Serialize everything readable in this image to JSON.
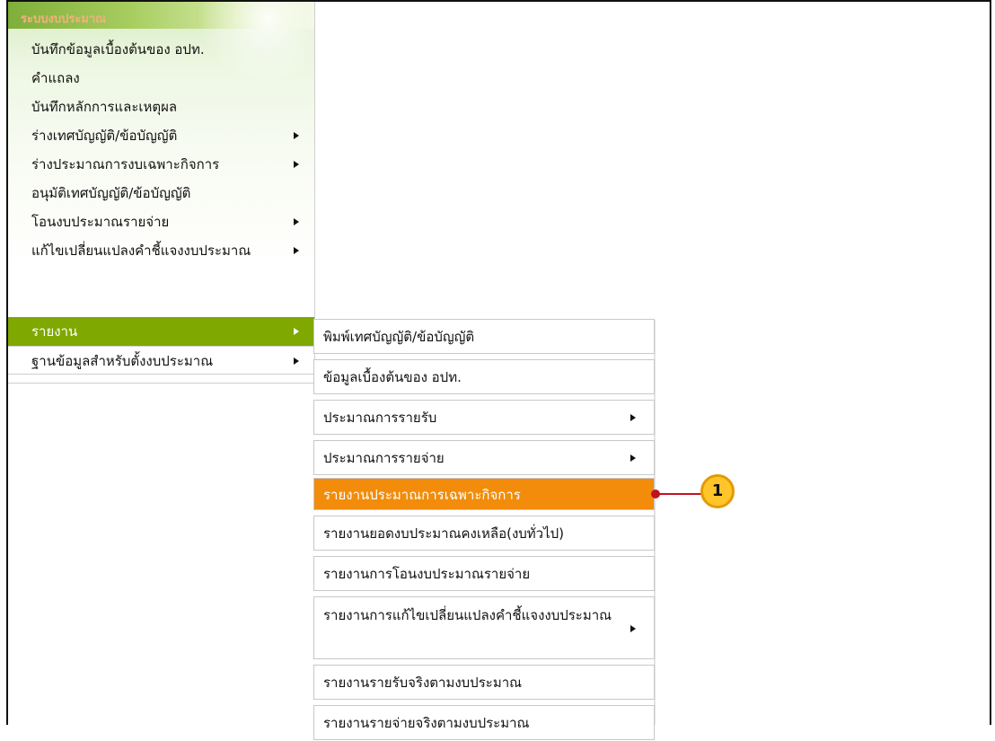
{
  "sidebar": {
    "title": "ระบบงบประมาณ",
    "items": [
      {
        "label": "บันทึกข้อมูลเบื้องต้นของ อปท.",
        "has_submenu": false
      },
      {
        "label": "คำแถลง",
        "has_submenu": false
      },
      {
        "label": "บันทึกหลักการและเหตุผล",
        "has_submenu": false
      },
      {
        "label": "ร่างเทศบัญญัติ/ข้อบัญญัติ",
        "has_submenu": true
      },
      {
        "label": "ร่างประมาณการงบเฉพาะกิจการ",
        "has_submenu": true
      },
      {
        "label": "อนุมัติเทศบัญญัติ/ข้อบัญญัติ",
        "has_submenu": false
      },
      {
        "label": "โอนงบประมาณรายจ่าย",
        "has_submenu": true
      },
      {
        "label": "แก้ไขเปลี่ยนแปลงคำชี้แจงงบประมาณ",
        "has_submenu": true
      },
      {
        "label": "รายงาน",
        "has_submenu": true,
        "active": true
      },
      {
        "label": "ฐานข้อมูลสำหรับตั้งงบประมาณ",
        "has_submenu": true
      }
    ]
  },
  "submenu": {
    "items": [
      {
        "label": "พิมพ์เทศบัญญัติ/ข้อบัญญัติ",
        "has_submenu": false
      },
      {
        "label": "ข้อมูลเบื้องต้นของ อปท.",
        "has_submenu": false
      },
      {
        "label": "ประมาณการรายรับ",
        "has_submenu": true
      },
      {
        "label": "ประมาณการรายจ่าย",
        "has_submenu": true
      },
      {
        "label": "รายงานประมาณการเฉพาะกิจการ",
        "has_submenu": false,
        "highlighted": true
      },
      {
        "label": "รายงานยอดงบประมาณคงเหลือ(งบทั่วไป)",
        "has_submenu": false
      },
      {
        "label": "รายงานการโอนงบประมาณรายจ่าย",
        "has_submenu": false
      },
      {
        "label": "รายงานการแก้ไขเปลี่ยนแปลงคำชี้แจงงบประมาณ",
        "has_submenu": true
      },
      {
        "label": "รายงานรายรับจริงตามงบประมาณ",
        "has_submenu": false
      },
      {
        "label": "รายงานรายจ่ายจริงตามงบประมาณ",
        "has_submenu": false
      }
    ]
  },
  "callout": {
    "number": "1"
  },
  "colors": {
    "active_menu": "#7fa800",
    "highlight": "#f28c0a",
    "callout": "#ffc52a"
  }
}
